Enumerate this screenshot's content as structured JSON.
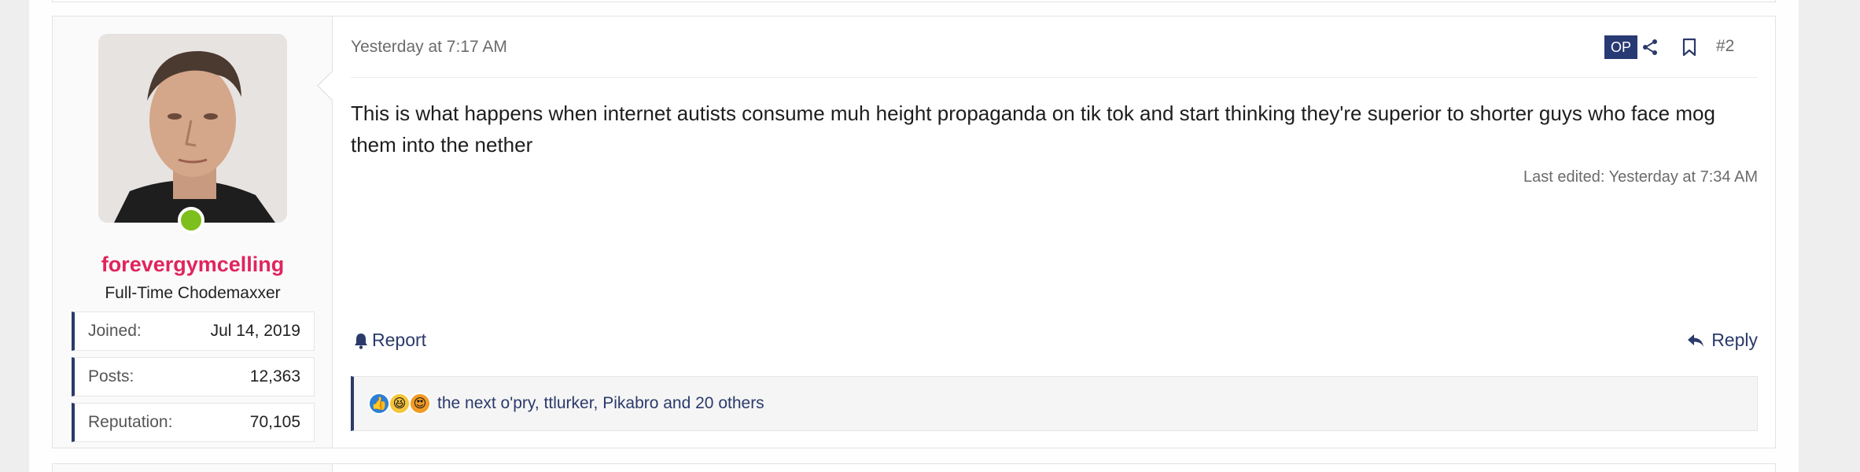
{
  "post": {
    "author": {
      "username": "forevergymcelling",
      "title": "Full-Time Chodemaxxer",
      "online": true,
      "stats": [
        {
          "label": "Joined:",
          "value": "Jul 14, 2019"
        },
        {
          "label": "Posts:",
          "value": "12,363"
        },
        {
          "label": "Reputation:",
          "value": "70,105"
        }
      ]
    },
    "date": "Yesterday at 7:17 AM",
    "op_badge": "OP",
    "post_number": "#2",
    "body": "This is what happens when internet autists consume muh height propaganda on tik tok and start thinking they're superior to shorter guys who face mog them into the nether",
    "last_edited": "Last edited: Yesterday at 7:34 AM",
    "actions": {
      "report_label": "Report",
      "reply_label": "Reply"
    },
    "reactions": {
      "icons": [
        "like-icon",
        "laugh-icon",
        "love-icon"
      ],
      "text": "the next o'pry, ttlurker, Pikabro and 20 others"
    }
  },
  "colors": {
    "accent": "#2b3a6b",
    "username": "#e0245e",
    "online": "#7dbf1c",
    "op_badge_bg": "#283a73"
  }
}
